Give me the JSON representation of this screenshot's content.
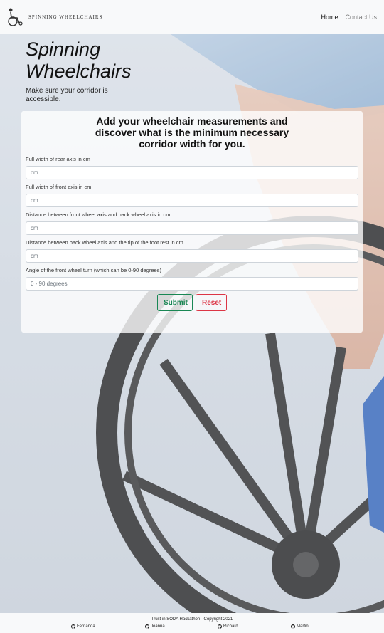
{
  "nav": {
    "brand_text": "Spinning Wheelchairs",
    "links": [
      {
        "label": "Home",
        "active": true
      },
      {
        "label": "Contact Us",
        "active": false
      }
    ]
  },
  "hero": {
    "title": "Spinning Wheelchairs",
    "subtitle": "Make sure your corridor is accessible."
  },
  "form": {
    "heading": "Add your wheelchair measurements and discover what is the minimum necessary corridor width for you.",
    "fields": [
      {
        "label": "Full width of rear axis in cm",
        "placeholder": "cm",
        "value": ""
      },
      {
        "label": "Full width of front axis in cm",
        "placeholder": "cm",
        "value": ""
      },
      {
        "label": "Distance between front wheel axis and back wheel axis in cm",
        "placeholder": "cm",
        "value": ""
      },
      {
        "label": "Distance between back wheel axis and the tip of the foot rest in cm",
        "placeholder": "cm",
        "value": ""
      },
      {
        "label": "Angle of the front wheel turn (which can be 0-90 degrees)",
        "placeholder": "0 - 90 degrees",
        "value": ""
      }
    ],
    "submit_label": "Submit",
    "reset_label": "Reset",
    "colors": {
      "submit": "#198754",
      "reset": "#dc3545"
    }
  },
  "footer": {
    "copyright": "Trust in SODA Hackathon - Copyright 2021",
    "authors": [
      {
        "name": "Fernanda",
        "icon": "github-icon"
      },
      {
        "name": "Joanna",
        "icon": "github-icon"
      },
      {
        "name": "Richard",
        "icon": "github-icon"
      },
      {
        "name": "Martin",
        "icon": "github-icon"
      }
    ]
  }
}
